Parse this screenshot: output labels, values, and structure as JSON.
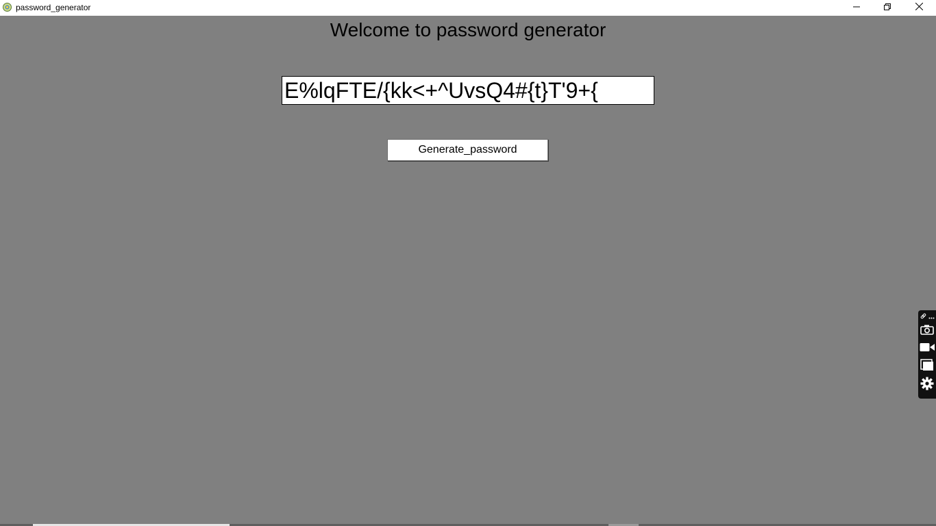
{
  "window": {
    "title": "password_generator"
  },
  "main": {
    "heading": "Welcome to password generator",
    "password_value": "E%lqFTE/{kk<+^UvsQ4#{t}T'9+{",
    "generate_label": "Generate_password"
  },
  "icons": {
    "app": "app-icon",
    "minimize": "minimize-icon",
    "maximize": "restore-icon",
    "close": "close-icon",
    "toolbar": [
      "link-icon",
      "more-icon",
      "camera-icon",
      "video-icon",
      "window-icon",
      "gear-icon"
    ]
  },
  "colors": {
    "background": "#808080",
    "titlebar": "#ffffff",
    "input_bg": "#ffffff",
    "toolbar_bg": "#111111"
  }
}
